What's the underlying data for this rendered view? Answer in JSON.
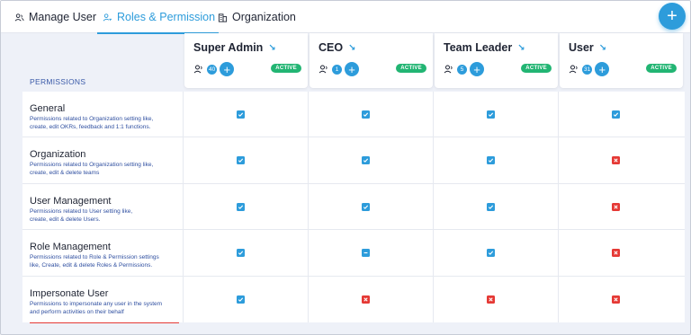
{
  "tabs": [
    {
      "label": "Manage User",
      "active": false,
      "icon": "users-icon"
    },
    {
      "label": "Roles & Permission",
      "active": true,
      "icon": "user-key-icon"
    },
    {
      "label": "Organization",
      "active": false,
      "icon": "building-icon"
    }
  ],
  "fab_label": "+",
  "permissions_header": "PERMISSIONS",
  "roles": [
    {
      "name": "Super Admin",
      "count": "40",
      "status": "ACTIVE"
    },
    {
      "name": "CEO",
      "count": "1",
      "status": "ACTIVE"
    },
    {
      "name": "Team Leader",
      "count": "5",
      "status": "ACTIVE"
    },
    {
      "name": "User",
      "count": "31",
      "status": "ACTIVE"
    }
  ],
  "permissions": [
    {
      "name": "General",
      "desc_line1": "Permissions related to Organization setting like,",
      "desc_line2": "create, edit OKRs, feedback and 1:1 functions.",
      "values": [
        "yes",
        "yes",
        "yes",
        "yes"
      ]
    },
    {
      "name": "Organization",
      "desc_line1": "Permissions related to Organization setting like,",
      "desc_line2": "create, edit & delete teams",
      "values": [
        "yes",
        "yes",
        "yes",
        "no"
      ]
    },
    {
      "name": "User Management",
      "desc_line1": "Permissions related to User setting like,",
      "desc_line2": "create, edit & delete Users.",
      "values": [
        "yes",
        "yes",
        "yes",
        "no"
      ]
    },
    {
      "name": "Role Management",
      "desc_line1": "Permissions related to Role & Permission settings",
      "desc_line2": "like, Create, edit & delete Roles & Permissions.",
      "values": [
        "yes",
        "partial",
        "yes",
        "no"
      ]
    },
    {
      "name": "Impersonate User",
      "desc_line1": "Permissions to impersonate any user in the system",
      "desc_line2": "and perform activities on their behalf",
      "values": [
        "yes",
        "no",
        "no",
        "no"
      ]
    }
  ],
  "colors": {
    "accent": "#2d9cdb",
    "active_badge": "#22b573",
    "deny": "#e53935"
  }
}
